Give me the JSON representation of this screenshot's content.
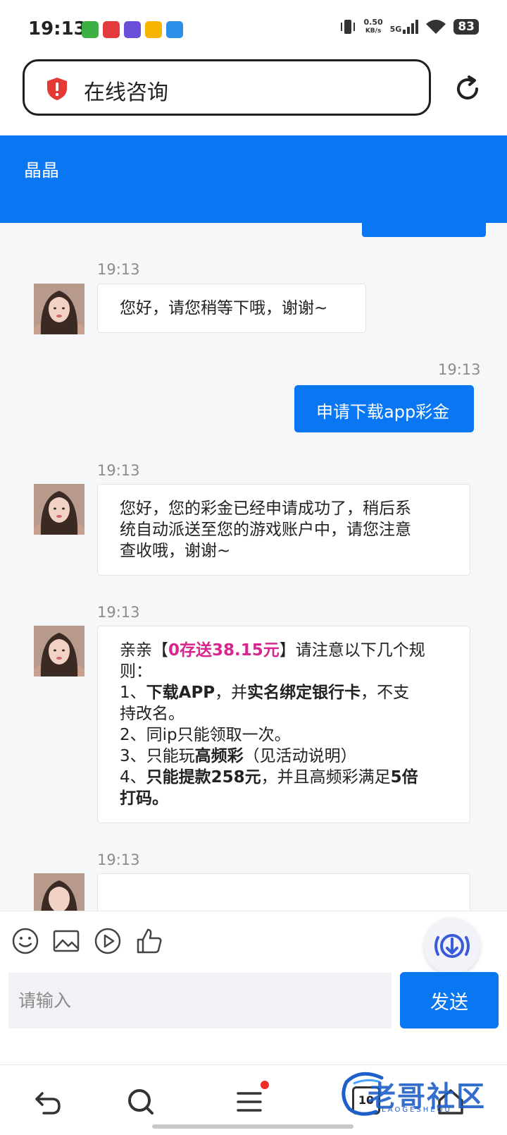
{
  "status_bar": {
    "time": "19:13",
    "net_speed_value": "0.50",
    "net_speed_unit": "KB/s",
    "network": "5G",
    "battery": "83"
  },
  "browser": {
    "title": "在线咨询",
    "tab_count": "10"
  },
  "chat": {
    "agent_name": "晶晶",
    "messages": [
      {
        "time": "19:13",
        "text": "您好，请您稍等下哦，谢谢~"
      },
      {
        "time": "19:13",
        "text": "申请下载app彩金"
      },
      {
        "time": "19:13",
        "lines": [
          "您好，您的彩金已经申请成功了，稍后系",
          "统自动派送至您的游戏账户中，请您注意",
          "查收哦，谢谢~"
        ]
      },
      {
        "time": "19:13",
        "r1_a": "亲亲【",
        "r1_hl": "0存送38.15元",
        "r1_b": "】请注意以下几个规",
        "r2": "则：",
        "r3_a": "1、",
        "r3_b": "下载APP",
        "r3_c": "，并",
        "r3_d": "实名绑定银行卡",
        "r3_e": "，不支",
        "r4": "持改名。",
        "r5": "2、同ip只能领取一次。",
        "r6_a": "3、只能玩",
        "r6_b": "高频彩",
        "r6_c": "（见活动说明）",
        "r7_a": "4、",
        "r7_b": "只能提款258元",
        "r7_c": "，并且高频彩满足",
        "r7_d": "5倍",
        "r8": "打码。"
      },
      {
        "time": "19:13"
      }
    ]
  },
  "composer": {
    "placeholder": "请输入",
    "send_label": "发送"
  },
  "watermark": {
    "text": "老哥社区",
    "sub": "LAOGESHEQU"
  },
  "colors": {
    "primary": "#0a77f2",
    "highlight": "#d8268e"
  }
}
